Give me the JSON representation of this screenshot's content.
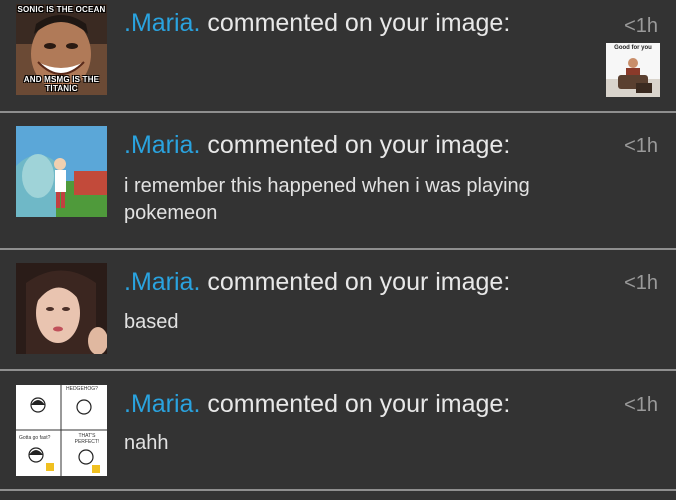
{
  "notifications": [
    {
      "user": ".Maria.",
      "action": " commented on your image:",
      "time": "<1h",
      "body": "",
      "thumb_top_text": "SONIC IS THE OCEAN",
      "thumb_bottom_text": "AND MSMG IS THE TITANIC",
      "reply_thumb_text": "Good for you"
    },
    {
      "user": ".Maria.",
      "action": " commented on your image:",
      "time": "<1h",
      "body": "i remember this happened when i was playing pokemeon"
    },
    {
      "user": ".Maria.",
      "action": " commented on your image:",
      "time": "<1h",
      "body": "based"
    },
    {
      "user": ".Maria.",
      "action": " commented on your image:",
      "time": "<1h",
      "body": "nahh",
      "thumb_comic_texts": [
        "HEDGEHOG?",
        "Gotta go fast?",
        "THAT'S PERFECT!"
      ]
    }
  ],
  "colors": {
    "username": "#2aa3df",
    "card_bg": "#333333",
    "divider": "#8f8f8f"
  }
}
